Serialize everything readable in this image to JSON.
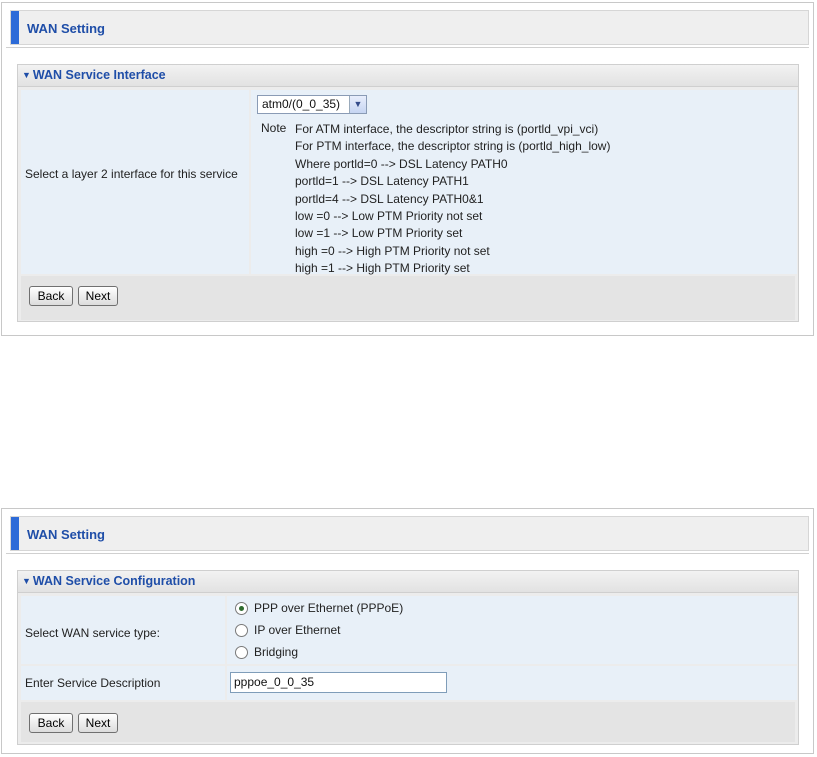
{
  "screen1": {
    "header_title": "WAN Setting",
    "panel_title": "WAN Service Interface",
    "label": "Select a layer 2 interface for this service",
    "select_value": "atm0/(0_0_35)",
    "note_key": "Note",
    "note_lines": [
      "For ATM interface, the descriptor string is (portld_vpi_vci)",
      "For PTM interface, the descriptor string is (portld_high_low)",
      "Where portld=0 --> DSL Latency PATH0",
      "portld=1 --> DSL Latency PATH1",
      "portld=4 --> DSL Latency PATH0&1",
      "low =0 --> Low PTM Priority not set",
      "low =1 --> Low PTM Priority set",
      "high =0 --> High PTM Priority not set",
      "high =1 --> High PTM Priority set"
    ],
    "back_label": "Back",
    "next_label": "Next"
  },
  "screen2": {
    "header_title": "WAN Setting",
    "panel_title": "WAN Service Configuration",
    "service_type_label": "Select WAN service type:",
    "service_options": [
      {
        "label": "PPP over Ethernet (PPPoE)",
        "selected": true
      },
      {
        "label": "IP over Ethernet",
        "selected": false
      },
      {
        "label": "Bridging",
        "selected": false
      }
    ],
    "description_label": "Enter Service Description",
    "description_value": "pppoe_0_0_35",
    "back_label": "Back",
    "next_label": "Next"
  },
  "colors": {
    "accent": "#2d6bd8",
    "title_blue": "#1f4ea8",
    "cell_bg": "#e8f0f8"
  }
}
